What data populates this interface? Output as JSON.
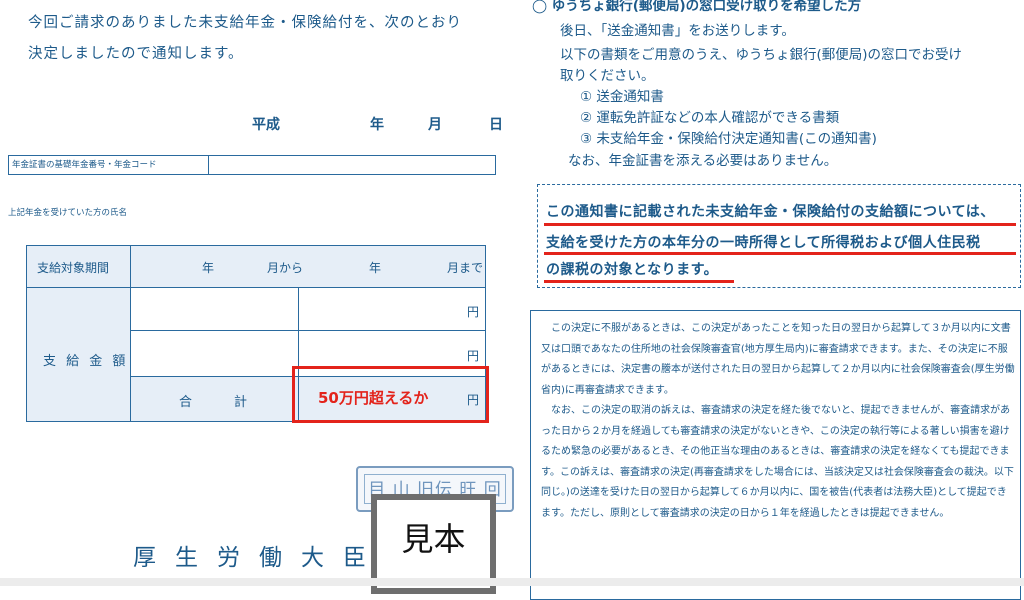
{
  "intro": {
    "line1": "今回ご請求のありました未支給年金・保険給付を、次のとおり",
    "line2": "決定しましたので通知します。"
  },
  "date": {
    "era": "平成",
    "year": "年",
    "month": "月",
    "day": "日"
  },
  "code_field": {
    "label": "年金証書の基礎年金番号・年金コード",
    "value": ""
  },
  "name_label": "上記年金を受けていた方の氏名",
  "pay_table": {
    "period_label": "支給対象期間",
    "from_year": "年",
    "from_month": "月から",
    "to_year": "年",
    "to_month": "月まで",
    "amount_label": "支 給 金 額",
    "yen1": "円",
    "yen2": "円",
    "total_label_1": "合",
    "total_label_2": "計",
    "total_yen": "円"
  },
  "annotation": {
    "text": "50万円超えるか",
    "color": "#e3231b"
  },
  "stamp": {
    "text": "目 山 旧伝 旺 回"
  },
  "sample_label": "見本",
  "minister": "厚生労働大臣",
  "right": {
    "option_line": "◯ ゆうちょ銀行(郵便局)の窓口受け取りを希望した方",
    "line1": "後日、「送金通知書」をお送りします。",
    "line2": "以下の書類をご用意のうえ、ゆうちょ銀行(郵便局)の窓口でお受け",
    "line3": "取りください。",
    "item1": "① 送金通知書",
    "item2": "② 運転免許証などの本人確認ができる書類",
    "item3": "③ 未支給年金・保険給付決定通知書(この通知書)",
    "line4": "なお、年金証書を添える必要はありません。"
  },
  "notice": {
    "line1": "この通知書に記載された未支給年金・保険給付の支給額については、",
    "line2": "支給を受けた方の本年分の一時所得として所得税および個人住民税",
    "line3": "の課税の対象となります。"
  },
  "appeal": {
    "p1": "この決定に不服があるときは、この決定があったことを知った日の翌日から起算して３か月以内に文書又は口頭であなたの住所地の社会保険審査官(地方厚生局内)に審査請求できます。また、その決定に不服があるときには、決定書の謄本が送付された日の翌日から起算して２か月以内に社会保険審査会(厚生労働省内)に再審査請求できます。",
    "p2": "なお、この決定の取消の訴えは、審査請求の決定を経た後でないと、提起できませんが、審査請求があった日から２か月を経過しても審査請求の決定がないときや、この決定の執行等による著しい損害を避けるため緊急の必要があるとき、その他正当な理由のあるときは、審査請求の決定を経なくても提起できます。この訴えは、審査請求の決定(再審査請求をした場合には、当該決定又は社会保険審査会の裁決。以下同じ。)の送達を受けた日の翌日から起算して６か月以内に、国を被告(代表者は法務大臣)として提起できます。ただし、原則として審査請求の決定の日から１年を経過したときは提起できません。"
  }
}
